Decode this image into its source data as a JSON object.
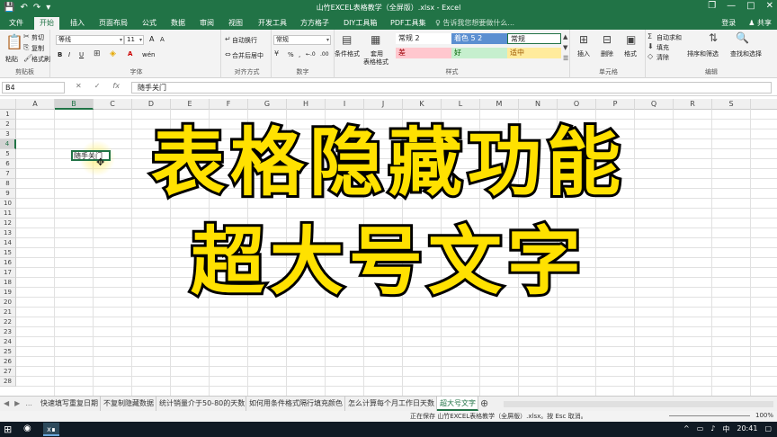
{
  "app": {
    "title": "山竹EXCEL表格教学（全屏版）.xlsx - Excel",
    "accent": "#217346"
  },
  "qat": {
    "save": "💾",
    "undo": "↶",
    "redo": "↷",
    "more": "▾"
  },
  "window_controls": {
    "restore": "❐",
    "minimize": "—",
    "maximize": "□",
    "close": "✕"
  },
  "tabs": [
    "文件",
    "开始",
    "插入",
    "页面布局",
    "公式",
    "数据",
    "审阅",
    "视图",
    "开发工具",
    "方方格子",
    "DIY工具箱",
    "PDF工具集"
  ],
  "active_tab": "开始",
  "tellme": "告诉我您想要做什么...",
  "account": {
    "login": "登录",
    "share": "共享"
  },
  "ribbon": {
    "clipboard": {
      "label": "剪贴板",
      "paste": "粘贴",
      "cut": "剪切",
      "copy": "复制",
      "format_painter": "格式刷"
    },
    "font": {
      "label": "字体",
      "name": "等线",
      "size": "11",
      "bold": "B",
      "italic": "I",
      "underline": "U",
      "grow": "A",
      "shrink": "A",
      "wen": "wén"
    },
    "alignment": {
      "label": "对齐方式",
      "wrap": "自动换行",
      "merge": "合并后居中"
    },
    "number": {
      "label": "数字",
      "format": "常规",
      "percent": "%",
      "comma": ",",
      "inc": "←.0",
      "dec": ".00"
    },
    "styles": {
      "label": "样式",
      "conditional": "条件格式",
      "table": "套用\n表格格式",
      "table_l1": "套用",
      "table_l2": "表格格式",
      "cells": [
        {
          "text": "常规 2",
          "bg": "#ffffff",
          "fg": "#222222"
        },
        {
          "text": "着色 5 2",
          "bg": "#5b8fd1",
          "fg": "#ffffff"
        },
        {
          "text": "常规",
          "bg": "#ffffff",
          "fg": "#222222"
        },
        {
          "text": "差",
          "bg": "#ffc7ce",
          "fg": "#9c0006"
        },
        {
          "text": "好",
          "bg": "#c6efce",
          "fg": "#006100"
        },
        {
          "text": "适中",
          "bg": "#ffeb9c",
          "fg": "#9c5700"
        }
      ]
    },
    "cells_group": {
      "label": "单元格",
      "insert": "插入",
      "delete": "删除",
      "format": "格式"
    },
    "editing": {
      "label": "编辑",
      "autosum": "自动求和",
      "fill": "填充",
      "clear": "清除",
      "sort": "排序和筛选",
      "find": "查找和选择"
    }
  },
  "formula_bar": {
    "name_box": "B4",
    "cancel": "✕",
    "enter": "✓",
    "fx": "fx",
    "content": "随手关门"
  },
  "columns": [
    "A",
    "B",
    "C",
    "D",
    "E",
    "F",
    "G",
    "H",
    "I",
    "J",
    "K",
    "L",
    "M",
    "N",
    "O",
    "P",
    "Q",
    "R",
    "S"
  ],
  "rows": [
    "1",
    "2",
    "3",
    "4",
    "5",
    "6",
    "7",
    "8",
    "9",
    "10",
    "11",
    "12",
    "13",
    "14",
    "15",
    "16",
    "17",
    "18",
    "19",
    "20",
    "21",
    "22",
    "23",
    "24",
    "25",
    "26",
    "27",
    "28"
  ],
  "selected": {
    "col": "B",
    "row": "4"
  },
  "active_cell_text": "随手关门",
  "overlay": {
    "line1": "表格隐藏功能",
    "line2": "超大号文字"
  },
  "sheets": {
    "nav": {
      "prev": "◀",
      "next": "▶",
      "more": "..."
    },
    "tabs": [
      "快速填写重复日期",
      "不复制隐藏数据",
      "统计销量介于50-80的天数",
      "如何用条件格式隔行填充颜色",
      "怎么计算每个月工作日天数",
      "超大号文字"
    ],
    "active": "超大号文字",
    "add": "⊕"
  },
  "status": {
    "message": "正在保存 山竹EXCEL表格教学（全屏版）.xlsx。按 Esc 取消。",
    "zoom": "100%"
  },
  "taskbar": {
    "start": "⊞",
    "excel": "x∎",
    "ime": "中",
    "time": "20:41"
  }
}
